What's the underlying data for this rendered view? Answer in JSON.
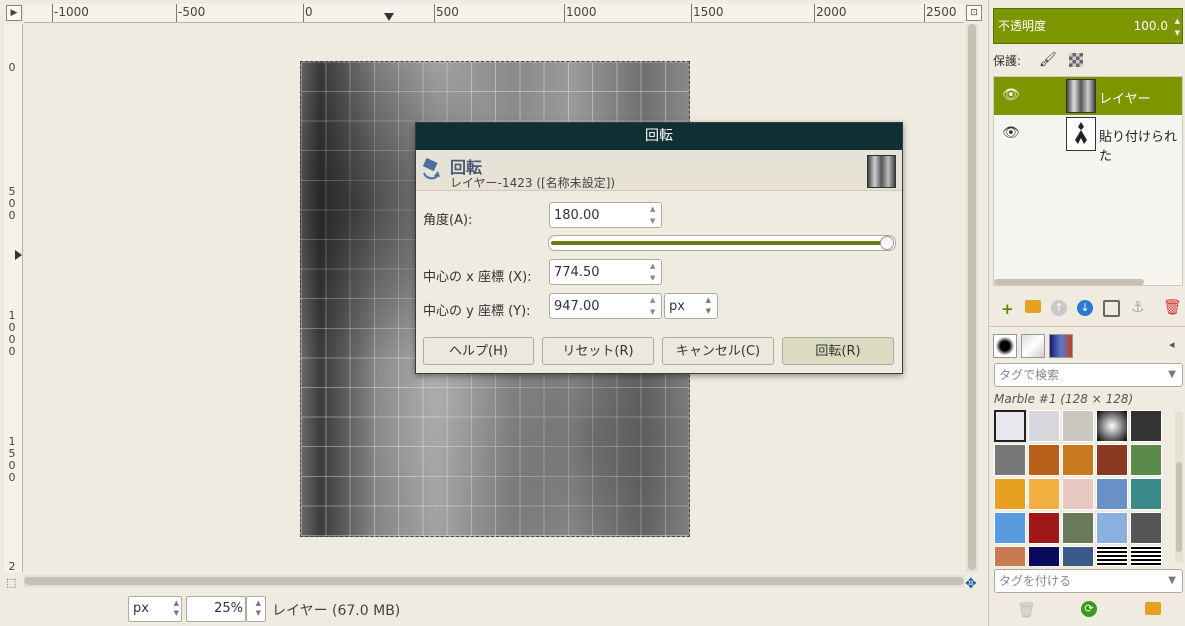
{
  "ruler": {
    "h_labels": [
      "-1000",
      "-500",
      "0",
      "500",
      "1000",
      "1500",
      "2000",
      "2500"
    ],
    "v_labels": [
      [
        "0"
      ],
      [
        "5",
        "0",
        "0"
      ],
      [
        "1",
        "0",
        "0",
        "0"
      ],
      [
        "1",
        "5",
        "0",
        "0"
      ],
      [
        "2"
      ]
    ]
  },
  "status": {
    "unit": "px",
    "zoom": "25",
    "zoom_unit": "%",
    "layer_info": "レイヤー (67.0 MB)"
  },
  "dialog": {
    "title": "回転",
    "header_title": "回転",
    "header_subtitle": "レイヤー-1423 ([名称未設定])",
    "angle_label": "角度(A):",
    "angle_value": "180.00",
    "angle_fraction": 1.0,
    "cx_label": "中心の x 座標 (X):",
    "cx_value": "774.50",
    "cy_label": "中心の y 座標 (Y):",
    "cy_value": "947.00",
    "unit": "px",
    "buttons": {
      "help": "ヘルプ(H)",
      "reset": "リセット(R)",
      "cancel": "キャンセル(C)",
      "rotate": "回転(R)"
    }
  },
  "layers": {
    "opacity_label": "不透明度",
    "opacity_value": "100.0",
    "lock_label": "保護:",
    "items": [
      {
        "name": "レイヤー",
        "selected": true
      },
      {
        "name": "貼り付けられた",
        "selected": false
      }
    ]
  },
  "patterns": {
    "search_placeholder": "タグで検索",
    "selected_name": "Marble #1 (128 × 128)",
    "tag_placeholder": "タグを付ける"
  },
  "colors": {
    "accent": "#7c9600",
    "titlebar": "#0f2f35"
  }
}
